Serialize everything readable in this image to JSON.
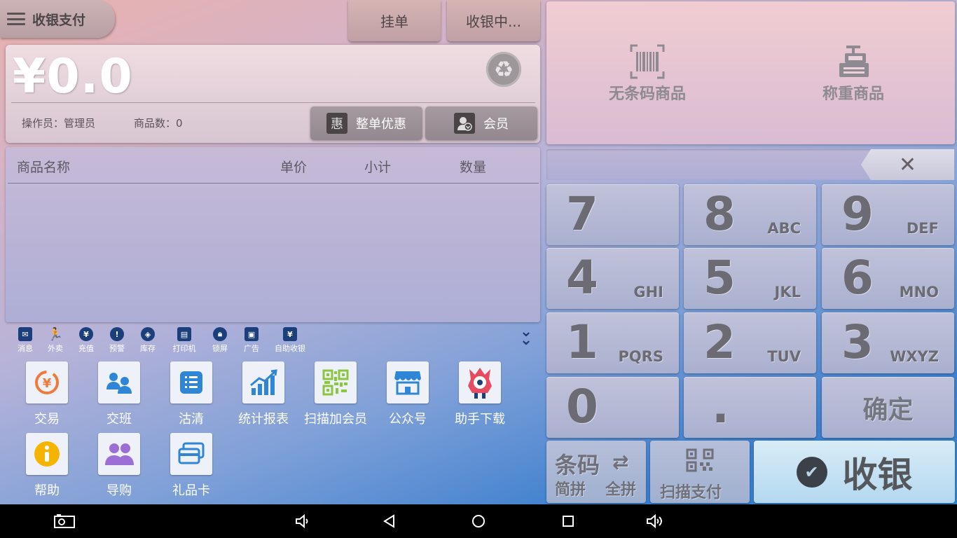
{
  "header": {
    "menu_label": "收银支付",
    "hold_order_label": "挂单",
    "cashier_status_label": "收银中..."
  },
  "amount_panel": {
    "amount": "¥0.0",
    "operator": "操作员：管理员",
    "item_count": "商品数：0",
    "discount_label": "整单优惠",
    "discount_icon_char": "惠",
    "member_label": "会员"
  },
  "product_table": {
    "columns": [
      "商品名称",
      "单价",
      "小计",
      "数量"
    ],
    "rows": []
  },
  "tools": [
    {
      "label": "消息",
      "icon": "message-icon"
    },
    {
      "label": "外卖",
      "icon": "delivery-runner-icon"
    },
    {
      "label": "充值",
      "icon": "recharge-yen-icon"
    },
    {
      "label": "预警",
      "icon": "warning-icon"
    },
    {
      "label": "库存",
      "icon": "inventory-icon"
    },
    {
      "label": "打印机",
      "icon": "printer-icon"
    },
    {
      "label": "锁屏",
      "icon": "lock-icon"
    },
    {
      "label": "广告",
      "icon": "ad-icon"
    },
    {
      "label": "自助收银",
      "icon": "self-checkout-icon"
    }
  ],
  "apps": [
    {
      "label": "交易",
      "icon": "transaction-icon",
      "color": "#f07a3a"
    },
    {
      "label": "交班",
      "icon": "shift-handover-icon",
      "color": "#2f86d6"
    },
    {
      "label": "沽清",
      "icon": "sold-out-list-icon",
      "color": "#2f86d6"
    },
    {
      "label": "统计报表",
      "icon": "statistics-chart-icon",
      "color": "#2f86d6"
    },
    {
      "label": "扫描加会员",
      "icon": "qr-add-member-icon",
      "color": "#8cc63f"
    },
    {
      "label": "公众号",
      "icon": "official-account-store-icon",
      "color": "#2f86d6"
    },
    {
      "label": "助手下载",
      "icon": "assistant-mascot-icon",
      "color": "#e84a5f"
    },
    {
      "label": "帮助",
      "icon": "help-info-icon",
      "color": "#f5b400"
    },
    {
      "label": "导购",
      "icon": "shopping-guide-icon",
      "color": "#9b6fd6"
    },
    {
      "label": "礼品卡",
      "icon": "gift-card-icon",
      "color": "#2f86d6"
    }
  ],
  "goods_shortcuts": {
    "no_barcode_label": "无条码商品",
    "weighed_label": "称重商品"
  },
  "input": {
    "value": "",
    "clear_symbol": "✕"
  },
  "keypad": {
    "keys": [
      {
        "digit": "7",
        "letters": ""
      },
      {
        "digit": "8",
        "letters": "ABC"
      },
      {
        "digit": "9",
        "letters": "DEF"
      },
      {
        "digit": "4",
        "letters": "GHI"
      },
      {
        "digit": "5",
        "letters": "JKL"
      },
      {
        "digit": "6",
        "letters": "MNO"
      },
      {
        "digit": "1",
        "letters": "PQRS"
      },
      {
        "digit": "2",
        "letters": "TUV"
      },
      {
        "digit": "3",
        "letters": "WXYZ"
      },
      {
        "digit": "0",
        "letters": ""
      },
      {
        "digit": ".",
        "letters": ""
      }
    ],
    "confirm_label": "确定"
  },
  "bottom_actions": {
    "barcode_label": "条码",
    "jianpin_label": "简拼",
    "quanpin_label": "全拼",
    "scan_pay_label": "扫描支付",
    "checkout_label": "收银"
  }
}
